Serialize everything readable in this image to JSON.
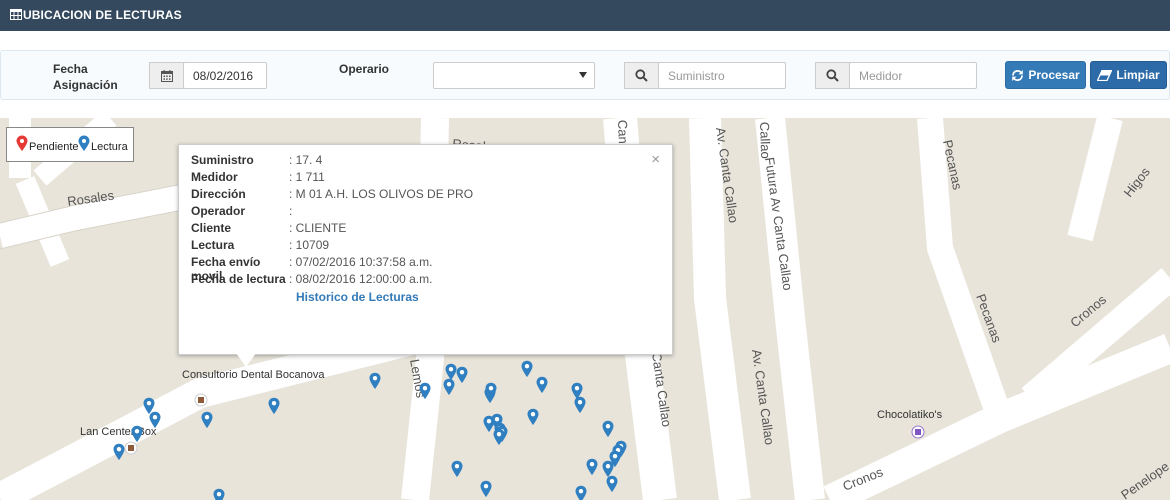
{
  "header": {
    "title": "UBICACION DE LECTURAS",
    "icon": "table-icon"
  },
  "filters": {
    "fecha_label": "Fecha\nAsignación",
    "fecha_value": "08/02/2016",
    "operario_label": "Operario",
    "operario_value": "",
    "suministro_placeholder": "Suministro",
    "medidor_placeholder": "Medidor",
    "procesar_label": "Procesar",
    "limpiar_label": "Limpiar"
  },
  "colors": {
    "header_bg": "#34495e",
    "btn_blue": "#337ab7",
    "pin_blue": "#2f7fc1",
    "pin_red": "#e53935"
  },
  "map": {
    "legend": {
      "pendiente": "Pendiente",
      "lectura": "Lectura"
    },
    "street_labels": [
      "Rosales",
      "Rosales",
      "Cantu",
      "Callao",
      "Av. Canta Callao",
      "Futura Av Canta Callao",
      "Av. Canta Callao",
      "Canta Callao",
      "Pecanas",
      "Pecanas",
      "Higos",
      "Cronos",
      "Cronos",
      "Lemos",
      "Penelope",
      "Chocolatiko's",
      "Consultorio Dental Bocanova",
      "Lan Center Box"
    ],
    "popup": {
      "rows": [
        {
          "label": "Suministro",
          "value": ": 17.     4"
        },
        {
          "label": "Medidor",
          "value": ": 1     711"
        },
        {
          "label": "Dirección",
          "value": ": M 01              A.H. LOS OLIVOS DE PRO"
        },
        {
          "label": "Operador",
          "value": ":"
        },
        {
          "label": "Cliente",
          "value": ": CLIENTE"
        },
        {
          "label": "Lectura",
          "value": ": 10709"
        },
        {
          "label": "Fecha envío movil",
          "value": ": 07/02/2016 10:37:58 a.m."
        },
        {
          "label": "Fecha de lectura",
          "value": ": 08/02/2016 12:00:00 a.m."
        }
      ],
      "link": "Historico de Lecturas",
      "close": "×"
    }
  }
}
